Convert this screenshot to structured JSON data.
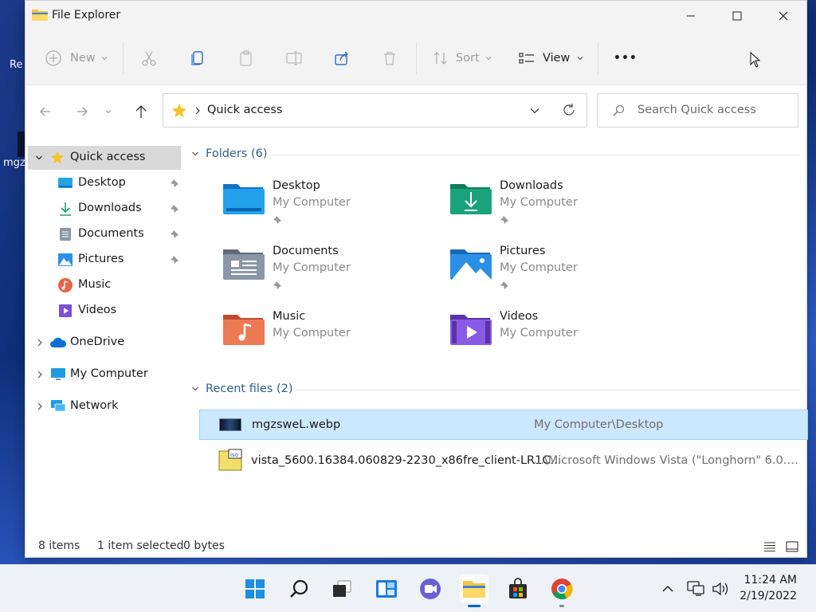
{
  "window": {
    "title": "File Explorer"
  },
  "toolbar": {
    "new_label": "New",
    "sort_label": "Sort",
    "view_label": "View",
    "more_label": "•••"
  },
  "address": {
    "current": "Quick access"
  },
  "search": {
    "placeholder": "Search Quick access"
  },
  "sidebar": {
    "quick_access": "Quick access",
    "items": [
      {
        "label": "Desktop",
        "pinned": true
      },
      {
        "label": "Downloads",
        "pinned": true
      },
      {
        "label": "Documents",
        "pinned": true
      },
      {
        "label": "Pictures",
        "pinned": true
      },
      {
        "label": "Music",
        "pinned": false
      },
      {
        "label": "Videos",
        "pinned": false
      }
    ],
    "onedrive": "OneDrive",
    "my_computer": "My Computer",
    "network": "Network"
  },
  "folders": {
    "header": "Folders (6)",
    "items": [
      {
        "name": "Desktop",
        "location": "My Computer",
        "color": "#1e90e0"
      },
      {
        "name": "Downloads",
        "location": "My Computer",
        "color": "#1aa37a"
      },
      {
        "name": "Documents",
        "location": "My Computer",
        "color": "#8a96a8"
      },
      {
        "name": "Pictures",
        "location": "My Computer",
        "color": "#2c8fe6"
      },
      {
        "name": "Music",
        "location": "My Computer",
        "color": "#e8634a"
      },
      {
        "name": "Videos",
        "location": "My Computer",
        "color": "#7d4fd8"
      }
    ]
  },
  "recent": {
    "header": "Recent files (2)",
    "files": [
      {
        "name": "mgzsweL.webp",
        "path": "My Computer\\Desktop"
      },
      {
        "name": "vista_5600.16384.060829-2230_x86fre_client-LR1C...",
        "path": "...\\Microsoft Windows Vista (\"Longhorn\" 6.0.5600...."
      }
    ]
  },
  "status": {
    "items": "8 items",
    "selected": "1 item selected",
    "size": "0 bytes"
  },
  "tray": {
    "time": "11:24 AM",
    "date": "2/19/2022"
  },
  "desktop": {
    "icon1_label": "Re",
    "icon2_label": "mgz"
  },
  "colors": {
    "accent": "#0067c0",
    "selection": "#cce8ff"
  }
}
